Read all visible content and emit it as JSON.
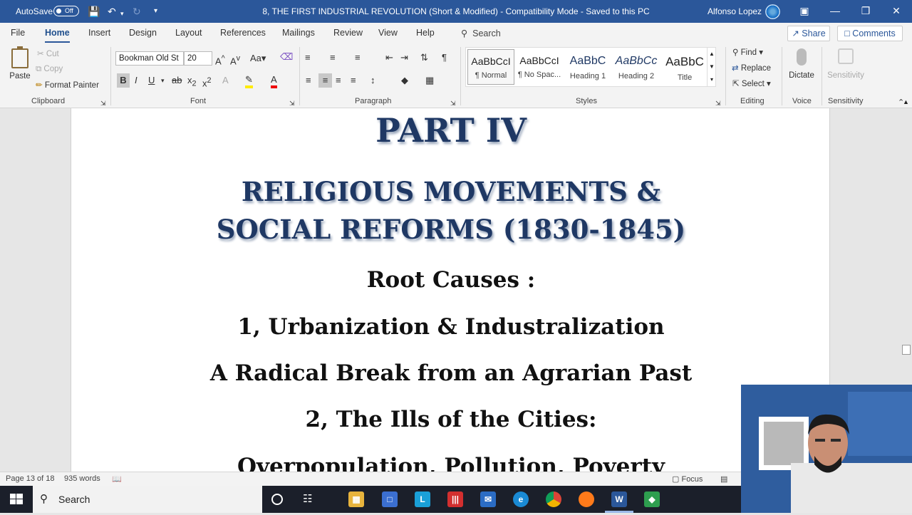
{
  "titlebar": {
    "autosave_label": "AutoSave",
    "autosave_state": "Off",
    "document_title": "8, THE FIRST INDUSTRIAL REVOLUTION  (Short & Modified)  -  Compatibility Mode  -  Saved to this PC",
    "user_name": "Alfonso Lopez",
    "accent_color": "#2b579a"
  },
  "tabs": {
    "items": [
      "File",
      "Home",
      "Insert",
      "Design",
      "Layout",
      "References",
      "Mailings",
      "Review",
      "View",
      "Help"
    ],
    "active": "Home",
    "search_label": "Search",
    "share_label": "Share",
    "comments_label": "Comments"
  },
  "ribbon": {
    "clipboard": {
      "paste": "Paste",
      "cut": "Cut",
      "copy": "Copy",
      "format_painter": "Format Painter",
      "group_label": "Clipboard"
    },
    "font": {
      "font_name": "Bookman Old St",
      "font_size": "20",
      "case_label": "Aa",
      "group_label": "Font"
    },
    "paragraph": {
      "group_label": "Paragraph"
    },
    "styles": {
      "items": [
        {
          "preview": "AaBbCcI",
          "name": "¶ Normal"
        },
        {
          "preview": "AaBbCcI",
          "name": "¶ No Spac..."
        },
        {
          "preview": "AaBbC",
          "name": "Heading 1"
        },
        {
          "preview": "AaBbCc",
          "name": "Heading 2"
        },
        {
          "preview": "AaBbC",
          "name": "Title"
        }
      ],
      "selected": "¶ Normal",
      "group_label": "Styles"
    },
    "editing": {
      "find": "Find",
      "replace": "Replace",
      "select": "Select",
      "group_label": "Editing"
    },
    "voice": {
      "dictate": "Dictate",
      "group_label": "Voice"
    },
    "sensitivity": {
      "button": "Sensitivity",
      "group_label": "Sensitivity"
    }
  },
  "document": {
    "heading": "PART IV",
    "title_line1": "RELIGIOUS MOVEMENTS &",
    "title_line2": "SOCIAL REFORMS (1830-1845)",
    "line1": "Root Causes :",
    "line2": "1, Urbanization & Industralization",
    "line3": "A Radical Break from an Agrarian Past",
    "line4": "2, The Ills of the Cities:",
    "line5": "Overpopulation, Pollution, Poverty"
  },
  "statusbar": {
    "page": "Page 13 of 18",
    "words": "935 words",
    "focus": "Focus"
  },
  "taskbar": {
    "search_label": "Search"
  }
}
